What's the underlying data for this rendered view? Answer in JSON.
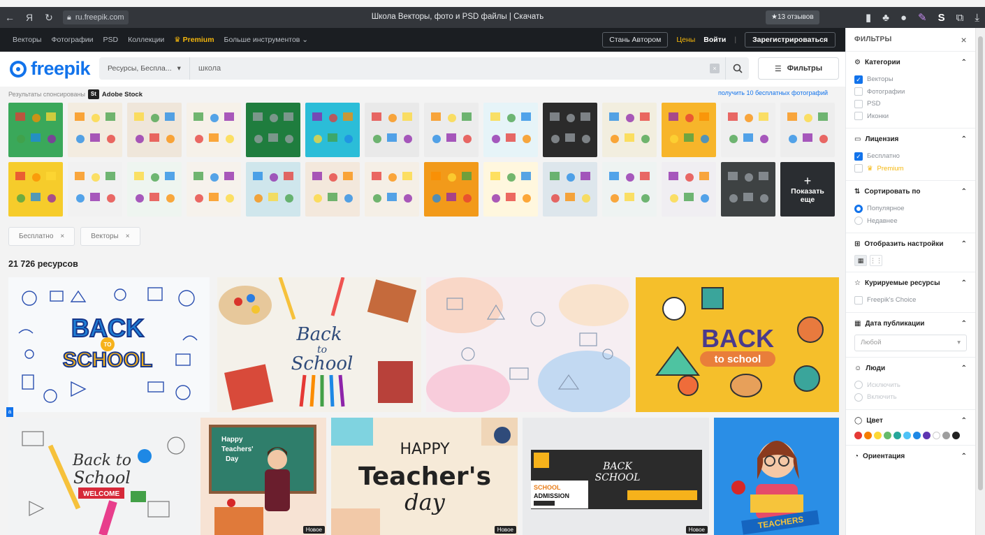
{
  "browser": {
    "url": "ru.freepik.com",
    "tab_title": "Школа Векторы, фото и PSD файлы | Скачать",
    "reviews_badge": "★13 отзывов"
  },
  "site_nav": {
    "items": [
      "Векторы",
      "Фотографии",
      "PSD",
      "Коллекции"
    ],
    "premium": "Premium",
    "more_tools": "Больше инструментов",
    "become_author": "Стань Автором",
    "prices": "Цены",
    "login": "Войти",
    "register": "Зарегистрироваться"
  },
  "search": {
    "logo_text": "freepik",
    "resource_select": "Ресурсы, Беспла...",
    "query": "школа",
    "filters_label": "Фильтры"
  },
  "sponsored": {
    "label": "Результаты спонсированы",
    "badge": "St",
    "brand": "Adobe Stock",
    "free_link": "получить 10 бесплатных фотографий",
    "show_more": [
      "Показать",
      "еще"
    ],
    "row1_colors": [
      "#3aa85a",
      "#f3ece0",
      "#efe6da",
      "#f6f1e9",
      "#1f7d3e",
      "#2bbdd8",
      "#e9e9e9",
      "#ececec",
      "#e6f4f8",
      "#2b2b2b",
      "#f2eedf",
      "#f7b52a",
      "#efefef",
      "#ededed"
    ],
    "row2_colors": [
      "#f6cc2b",
      "#f1f1f1",
      "#eef5f0",
      "#f6f2ec",
      "#cfe6ec",
      "#f3e8dc",
      "#f5efe6",
      "#f29a1a",
      "#fff7de",
      "#dde6ec",
      "#eef3f2",
      "#f0eef2",
      "#3e4243"
    ]
  },
  "tags": [
    {
      "label": "Бесплатно",
      "close": "×"
    },
    {
      "label": "Векторы",
      "close": "×"
    }
  ],
  "resource_count": "21 726 ресурсов",
  "results": {
    "row1": [
      {
        "text": [
          "BACK",
          "TO",
          "SCHOOL"
        ],
        "bg": "#f7f9fb"
      },
      {
        "text": [
          "Back",
          "to",
          "School"
        ],
        "bg": "#f4f1ea"
      },
      {
        "text": [],
        "bg": "#f6eef2"
      },
      {
        "text": [
          "BACK",
          "to school"
        ],
        "bg": "#f5bf2b"
      }
    ],
    "row2": [
      {
        "text": [
          "Back to",
          "School",
          "WELCOME"
        ],
        "bg": "#f2f3f4",
        "badge": ""
      },
      {
        "text": [
          "Happy",
          "Teachers'",
          "Day"
        ],
        "bg": "#f7e3d4",
        "badge": "Новое"
      },
      {
        "text": [
          "HAPPY",
          "Teacher's",
          "day"
        ],
        "bg": "#f6ead8",
        "badge": "Новое"
      },
      {
        "text": [
          "BACK",
          "SCHOOL",
          "SCHOOL",
          "ADMISSION"
        ],
        "bg": "#e9eaec",
        "badge": "Новое"
      },
      {
        "text": [
          "TEACHERS"
        ],
        "bg": "#2a8ee6",
        "badge": ""
      }
    ]
  },
  "panel": {
    "title": "ФИЛЬТРЫ",
    "close": "×",
    "categories": {
      "title": "Категории",
      "options": [
        "Векторы",
        "Фотографии",
        "PSD",
        "Иконки"
      ],
      "checked": [
        true,
        false,
        false,
        false
      ]
    },
    "license": {
      "title": "Лицензия",
      "options": [
        "Бесплатно",
        "Premium"
      ],
      "checked": [
        true,
        false
      ]
    },
    "sort": {
      "title": "Сортировать по",
      "options": [
        "Популярное",
        "Недавнее"
      ],
      "selected": 0
    },
    "display": {
      "title": "Отобразить настройки"
    },
    "curated": {
      "title": "Курируемые ресурсы",
      "option": "Freepik's Choice"
    },
    "date": {
      "title": "Дата публикации",
      "value": "Любой"
    },
    "people": {
      "title": "Люди",
      "options": [
        "Исключить",
        "Включить"
      ]
    },
    "color": {
      "title": "Цвет",
      "swatches": [
        "#e53935",
        "#f57c00",
        "#fdd835",
        "#66bb6a",
        "#26a69a",
        "#4fc3f7",
        "#1e88e5",
        "#5e35b1",
        "#ffffff",
        "#9e9e9e",
        "#212121"
      ]
    },
    "orientation": {
      "title": "Ориентация"
    }
  }
}
